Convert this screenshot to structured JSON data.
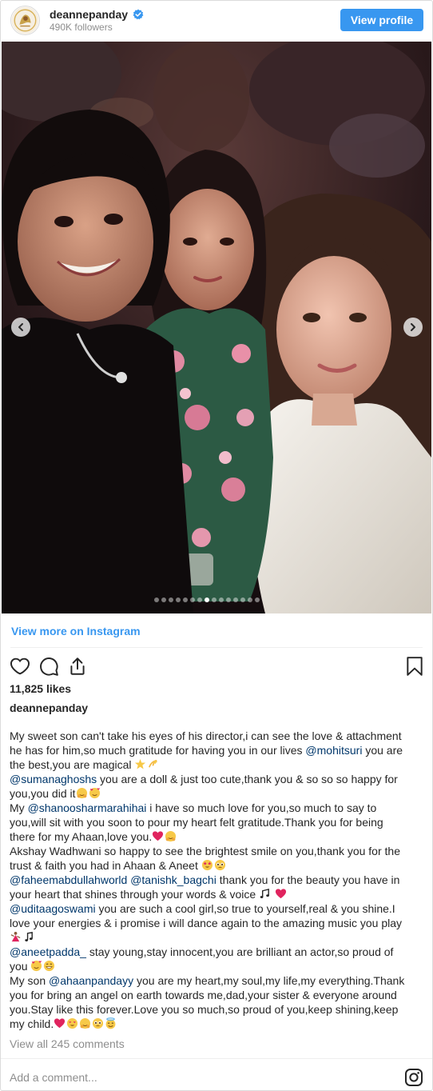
{
  "header": {
    "username": "deannepanday",
    "followers": "490K followers",
    "view_profile_label": "View profile"
  },
  "carousel": {
    "total_slides": 15,
    "active_index": 7
  },
  "view_more_label": "View more on Instagram",
  "likes": "11,825 likes",
  "caption_username": "deannepanday",
  "caption": {
    "l1": "My sweet son can't take his eyes of his director,i can see the love & attachment",
    "l2_a": "he has for him,so much gratitude for having you in our lives ",
    "l2_m": "@mohitsuri",
    "l2_b": " you are",
    "l3": "the best,you are magical ",
    "l4_m": "@sumanaghoshs",
    "l4_b": " you are a doll & just too cute,thank you & so so so happy for",
    "l5": "you,you did it",
    "l6_a": "My ",
    "l6_m": "@shanoosharmarahihai",
    "l6_b": " i have so much love for you,so much to say to",
    "l7": "you,will sit with you soon to pour my heart felt gratitude.Thank you for being",
    "l8": "there for my Ahaan,love you.",
    "l9": "Akshay Wadhwani so happy to see the brightest smile on you,thank you for the",
    "l10": "trust & faith you had in Ahaan & Aneet ",
    "l11_m1": "@faheemabdullahworld",
    "l11_sp": " ",
    "l11_m2": "@tanishk_bagchi",
    "l11_b": " thank you for the beauty you have in",
    "l12": "your heart that shines through your words & voice ",
    "l13_m": "@uditaagoswami",
    "l13_b": " you are such a cool girl,so true to yourself,real & you shine.I",
    "l14": "love your energies & i promise i will dance again to the amazing music you play",
    "l16_m": "@aneetpadda_",
    "l16_b": " stay young,stay innocent,you are brilliant an actor,so proud of",
    "l17": "you ",
    "l18_a": "My son ",
    "l18_m": "@ahaanpandayy",
    "l18_b": " you are my heart,my soul,my life,my everything.Thank",
    "l19": "you for bring an angel on earth towards me,dad,your sister & everyone around",
    "l20": "you.Stay like this forever.Love you so much,so proud of you,keep shining,keep",
    "l21": "my child."
  },
  "view_comments_label": "View all 245 comments",
  "comment_placeholder": "Add a comment...",
  "colors": {
    "accent": "#3897f0",
    "mention": "#00376b",
    "muted": "#8e8e8e",
    "text": "#262626",
    "heart": "#e0245e"
  },
  "icons": [
    "verified-icon",
    "chevron-left-icon",
    "chevron-right-icon",
    "heart-icon",
    "comment-icon",
    "share-icon",
    "bookmark-icon",
    "instagram-icon"
  ]
}
